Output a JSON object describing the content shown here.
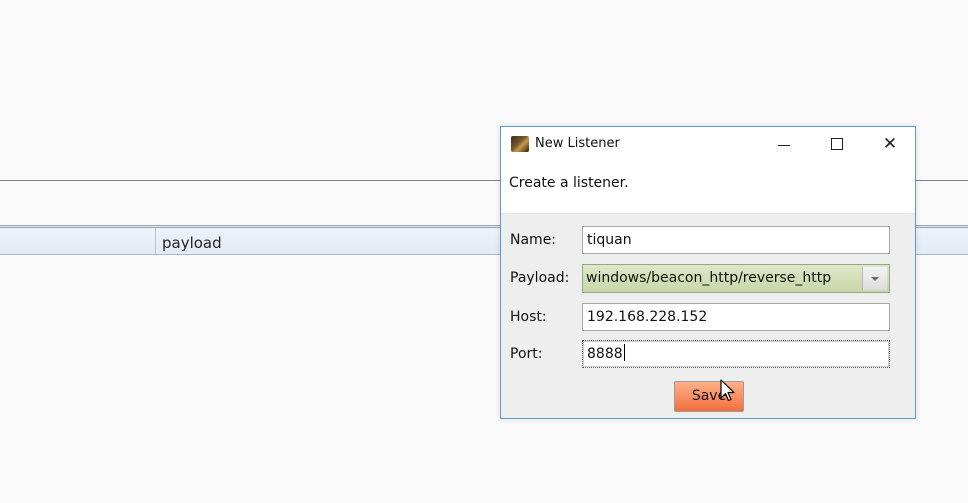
{
  "background": {
    "column_header": "payload"
  },
  "dialog": {
    "title": "New Listener",
    "description": "Create a listener.",
    "fields": {
      "name": {
        "label": "Name:",
        "value": "tiquan"
      },
      "payload": {
        "label": "Payload:",
        "value": "windows/beacon_http/reverse_http"
      },
      "host": {
        "label": "Host:",
        "value": "192.168.228.152"
      },
      "port": {
        "label": "Port:",
        "value": "8888"
      }
    },
    "save_label": "Save"
  },
  "colors": {
    "dialog_border": "#5b9bd5",
    "select_bg": "#c9d6a8",
    "save_button": "#f26f3d"
  },
  "icons": {
    "app": "app-icon",
    "minimize": "minimize-icon",
    "maximize": "maximize-icon",
    "close": "close-icon",
    "dropdown": "chevron-down-icon",
    "cursor": "mouse-cursor-icon"
  }
}
